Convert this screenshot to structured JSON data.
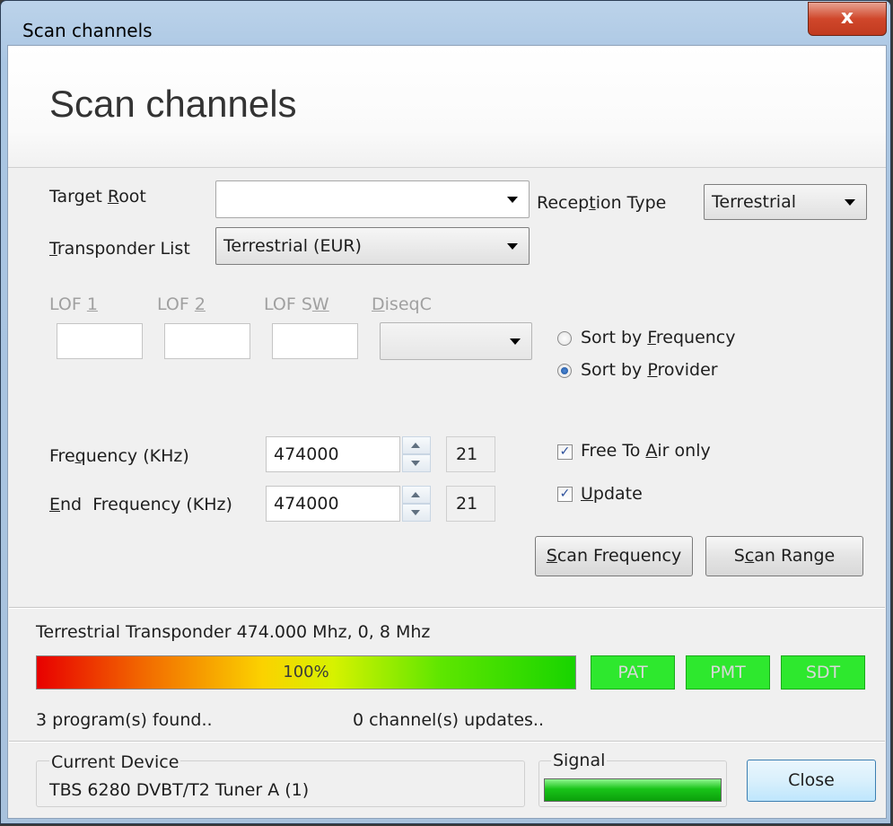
{
  "window": {
    "title": "Scan channels",
    "close_glyph": "x"
  },
  "header": {
    "title": "Scan channels"
  },
  "target_root": {
    "label": "Target Root",
    "value": ""
  },
  "reception_type": {
    "label": "Reception Type",
    "value": "Terrestrial"
  },
  "transponder_list": {
    "label": "Transponder List",
    "value": "Terrestrial (EUR)"
  },
  "lnb": {
    "lof1_label": "LOF 1",
    "lof2_label": "LOF 2",
    "lofsw_label": "LOF SW",
    "diseqc_label": "DiseqC",
    "lof1_value": "",
    "lof2_value": "",
    "lofsw_value": "",
    "diseqc_value": ""
  },
  "sort": {
    "by_frequency": "Sort by Frequency",
    "by_provider": "Sort by Provider",
    "selected": "provider"
  },
  "frequency": {
    "label": "Frequency (KHz)",
    "value": "474000",
    "channel": "21"
  },
  "end_frequency": {
    "label": "End  Frequency (KHz)",
    "value": "474000",
    "channel": "21"
  },
  "options": {
    "free_to_air_label": "Free To Air only",
    "free_to_air": true,
    "update_label": "Update",
    "update": true
  },
  "buttons": {
    "scan_frequency": "Scan Frequency",
    "scan_range": "Scan Range",
    "close": "Close"
  },
  "status": {
    "transponder": "Terrestrial Transponder 474.000 Mhz, 0, 8 Mhz",
    "progress_percent": 100,
    "progress_text": "100%",
    "pat": "PAT",
    "pmt": "PMT",
    "sdt": "SDT",
    "programs_found": "3 program(s) found..",
    "channel_updates": "0 channel(s) updates.."
  },
  "device": {
    "label": "Current Device",
    "name": "TBS 6280 DVBT/T2 Tuner A (1)"
  },
  "signal": {
    "label": "Signal",
    "level_fraction": 1.0
  },
  "colors": {
    "tag_green": "#2ee82e",
    "signal_green": "#19c419",
    "close_red": "#d0472b"
  }
}
